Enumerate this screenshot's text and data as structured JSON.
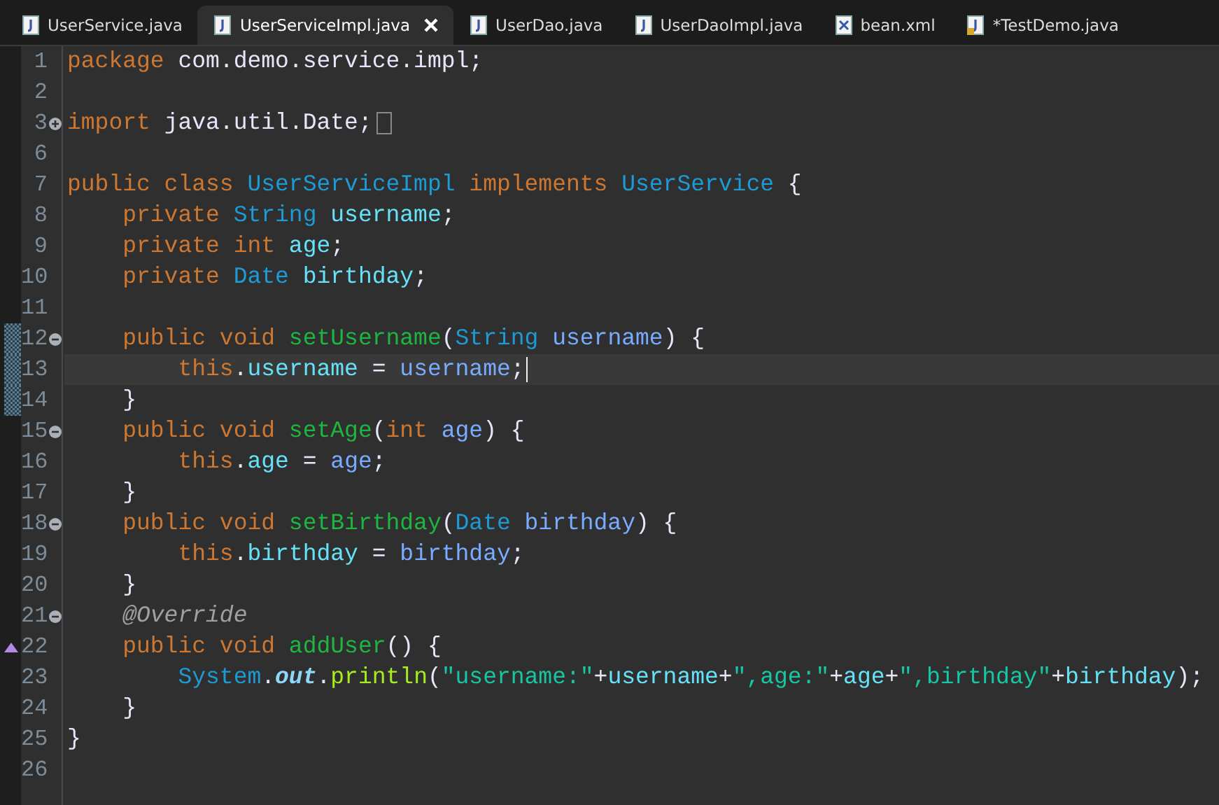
{
  "tabs": [
    {
      "label": "UserService.java",
      "kind": "java",
      "selected": false
    },
    {
      "label": "UserServiceImpl.java",
      "kind": "java",
      "selected": true
    },
    {
      "label": "UserDao.java",
      "kind": "java",
      "selected": false
    },
    {
      "label": "UserDaoImpl.java",
      "kind": "java",
      "selected": false
    },
    {
      "label": "bean.xml",
      "kind": "xml",
      "selected": false
    },
    {
      "label": "*TestDemo.java",
      "kind": "java-locked",
      "selected": false
    }
  ],
  "lines": [
    {
      "number": "1",
      "tokens": [
        {
          "kind": "keyword",
          "text": "package"
        },
        {
          "kind": "plain",
          "text": " com.demo.service.impl;"
        }
      ]
    },
    {
      "number": "2"
    },
    {
      "number": "3",
      "expanded": false,
      "tokens": [
        {
          "kind": "keyword",
          "text": "import"
        },
        {
          "kind": "plain",
          "text": " java.util.Date;"
        }
      ]
    },
    {
      "number": "6"
    },
    {
      "number": "7",
      "tokens": [
        {
          "kind": "keyword",
          "text": "public class"
        },
        {
          "kind": "type",
          "text": " UserServiceImpl"
        },
        {
          "kind": "keyword",
          "text": " implements"
        },
        {
          "kind": "type",
          "text": " UserService"
        },
        {
          "kind": "plain",
          "text": " {"
        }
      ]
    },
    {
      "number": "8",
      "tokens": [
        {
          "kind": "keyword",
          "text": "    private"
        },
        {
          "kind": "type",
          "text": " String"
        },
        {
          "kind": "field",
          "text": " username"
        },
        {
          "kind": "plain",
          "text": ";"
        }
      ]
    },
    {
      "number": "9",
      "tokens": [
        {
          "kind": "keyword",
          "text": "    private int"
        },
        {
          "kind": "field",
          "text": " age"
        },
        {
          "kind": "plain",
          "text": ";"
        }
      ]
    },
    {
      "number": "10",
      "tokens": [
        {
          "kind": "keyword",
          "text": "    private"
        },
        {
          "kind": "type",
          "text": " Date"
        },
        {
          "kind": "field",
          "text": " birthday"
        },
        {
          "kind": "plain",
          "text": ";"
        }
      ]
    },
    {
      "number": "11"
    },
    {
      "number": "12",
      "expanded": true,
      "changed": true,
      "tokens": [
        {
          "kind": "keyword",
          "text": "    public void"
        },
        {
          "kind": "method",
          "text": " setUsername"
        },
        {
          "kind": "plain",
          "text": "("
        },
        {
          "kind": "type",
          "text": "String"
        },
        {
          "kind": "param",
          "text": " username"
        },
        {
          "kind": "plain",
          "text": ") {"
        }
      ]
    },
    {
      "number": "13",
      "changed": true,
      "current": true,
      "tokens": [
        {
          "kind": "keyword",
          "text": "        this"
        },
        {
          "kind": "plain",
          "text": "."
        },
        {
          "kind": "field",
          "text": "username"
        },
        {
          "kind": "plain",
          "text": " ="
        },
        {
          "kind": "param",
          "text": " username"
        },
        {
          "kind": "plain",
          "text": ";"
        }
      ]
    },
    {
      "number": "14",
      "changed": true,
      "tokens": [
        {
          "kind": "plain",
          "text": "    }"
        }
      ]
    },
    {
      "number": "15",
      "expanded": true,
      "tokens": [
        {
          "kind": "keyword",
          "text": "    public void"
        },
        {
          "kind": "method",
          "text": " setAge"
        },
        {
          "kind": "plain",
          "text": "("
        },
        {
          "kind": "keyword",
          "text": "int"
        },
        {
          "kind": "param",
          "text": " age"
        },
        {
          "kind": "plain",
          "text": ") {"
        }
      ]
    },
    {
      "number": "16",
      "tokens": [
        {
          "kind": "keyword",
          "text": "        this"
        },
        {
          "kind": "plain",
          "text": "."
        },
        {
          "kind": "field",
          "text": "age"
        },
        {
          "kind": "plain",
          "text": " ="
        },
        {
          "kind": "param",
          "text": " age"
        },
        {
          "kind": "plain",
          "text": ";"
        }
      ]
    },
    {
      "number": "17",
      "tokens": [
        {
          "kind": "plain",
          "text": "    }"
        }
      ]
    },
    {
      "number": "18",
      "expanded": true,
      "tokens": [
        {
          "kind": "keyword",
          "text": "    public void"
        },
        {
          "kind": "method",
          "text": " setBirthday"
        },
        {
          "kind": "plain",
          "text": "("
        },
        {
          "kind": "type",
          "text": "Date"
        },
        {
          "kind": "param",
          "text": " birthday"
        },
        {
          "kind": "plain",
          "text": ") {"
        }
      ]
    },
    {
      "number": "19",
      "tokens": [
        {
          "kind": "keyword",
          "text": "        this"
        },
        {
          "kind": "plain",
          "text": "."
        },
        {
          "kind": "field",
          "text": "birthday"
        },
        {
          "kind": "plain",
          "text": " ="
        },
        {
          "kind": "param",
          "text": " birthday"
        },
        {
          "kind": "plain",
          "text": ";"
        }
      ]
    },
    {
      "number": "20",
      "tokens": [
        {
          "kind": "plain",
          "text": "    }"
        }
      ]
    },
    {
      "number": "21",
      "expanded": true,
      "tokens": [
        {
          "kind": "annotation",
          "text": "    @Override"
        }
      ]
    },
    {
      "number": "22",
      "override": true,
      "tokens": [
        {
          "kind": "keyword",
          "text": "    public void"
        },
        {
          "kind": "method",
          "text": " addUser"
        },
        {
          "kind": "plain",
          "text": "() {"
        }
      ]
    },
    {
      "number": "23",
      "tokens": [
        {
          "kind": "type",
          "text": "        System"
        },
        {
          "kind": "plain",
          "text": "."
        },
        {
          "kind": "static",
          "text": "out"
        },
        {
          "kind": "plain",
          "text": "."
        },
        {
          "kind": "call",
          "text": "println"
        },
        {
          "kind": "plain",
          "text": "("
        },
        {
          "kind": "string",
          "text": "\"username:\""
        },
        {
          "kind": "plain",
          "text": "+"
        },
        {
          "kind": "field",
          "text": "username"
        },
        {
          "kind": "plain",
          "text": "+"
        },
        {
          "kind": "string",
          "text": "\",age:\""
        },
        {
          "kind": "plain",
          "text": "+"
        },
        {
          "kind": "field",
          "text": "age"
        },
        {
          "kind": "plain",
          "text": "+"
        },
        {
          "kind": "string",
          "text": "\",birthday\""
        },
        {
          "kind": "plain",
          "text": "+"
        },
        {
          "kind": "field",
          "text": "birthday"
        },
        {
          "kind": "plain",
          "text": ");"
        }
      ]
    },
    {
      "number": "24",
      "tokens": [
        {
          "kind": "plain",
          "text": "    }"
        }
      ]
    },
    {
      "number": "25",
      "tokens": [
        {
          "kind": "plain",
          "text": "}"
        }
      ]
    },
    {
      "number": "26"
    }
  ]
}
